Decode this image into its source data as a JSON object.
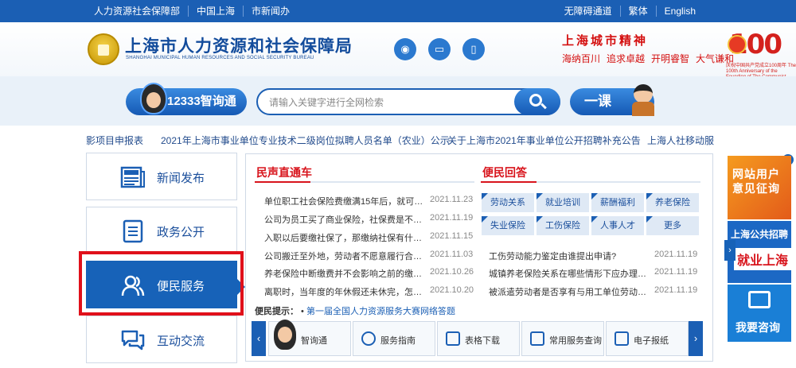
{
  "topbar": {
    "left_links": [
      "人力资源社会保障部",
      "中国上海",
      "市新闻办"
    ],
    "right_links": [
      "无障碍通道",
      "繁体",
      "English"
    ]
  },
  "header": {
    "logo_cn": "上海市人力资源和社会保障局",
    "logo_en": "SHANGHAI MUNICIPAL HUMAN RESOURCES AND SOCIAL SECURITY BUREAU",
    "slogan_title": "上海城市精神",
    "slogan_items": [
      "海纳百川",
      "追求卓越",
      "开明睿智",
      "大气谦和"
    ],
    "anniversary_number": "100",
    "anniversary_caption": "庆祝中国共产党成立100周年 The 100th Anniversary of the Founding of The Communist Party of China"
  },
  "search": {
    "btn_12333": "12333智询通",
    "placeholder": "请输入关键字进行全网检索",
    "btn_yike": "一课"
  },
  "ticker": {
    "items": [
      "影项目申报表",
      "2021年上海市事业单位专业技术二级岗位拟聘人员名单（农业）公示",
      "关于上海市2021年事业单位公开招聘补充公告",
      "上海人社移动服"
    ]
  },
  "nav": {
    "items": [
      {
        "label": "新闻发布"
      },
      {
        "label": "政务公开"
      },
      {
        "label": "便民服务"
      },
      {
        "label": "互动交流"
      }
    ]
  },
  "minsheng": {
    "title": "民声直通车",
    "rows": [
      {
        "title": "单位职工社会保险费缴满15年后，就可…",
        "date": "2021.11.23"
      },
      {
        "title": "公司为员工买了商业保险，社保费是不…",
        "date": "2021.11.19"
      },
      {
        "title": "入职以后要缴社保了，那缴纳社保有什…",
        "date": "2021.11.15"
      },
      {
        "title": "公司搬迁至外地，劳动者不愿意履行合…",
        "date": "2021.11.03"
      },
      {
        "title": "养老保险中断缴费并不会影响之前的缴…",
        "date": "2021.10.26"
      },
      {
        "title": "离职时，当年度的年休假还未休完，怎…",
        "date": "2021.10.20"
      }
    ]
  },
  "bianmin": {
    "title": "便民回答",
    "tags": [
      "劳动关系",
      "就业培训",
      "薪酬福利",
      "养老保险",
      "失业保险",
      "工伤保险",
      "人事人才",
      "更多"
    ],
    "rows": [
      {
        "title": "工伤劳动能力鉴定由谁提出申请?",
        "date": "2021.11.19"
      },
      {
        "title": "城镇养老保险关系在哪些情形下应办理…",
        "date": "2021.11.19"
      },
      {
        "title": "被派遣劳动者是否享有与用工单位劳动…",
        "date": "2021.11.19"
      }
    ]
  },
  "tip": {
    "label": "便民提示：",
    "text": "第一届全国人力资源服务大赛网络答题"
  },
  "quick": {
    "items": [
      "智询通",
      "服务指南",
      "表格下载",
      "常用服务查询",
      "电子报纸"
    ]
  },
  "right": {
    "banner1": "网站用户意见征询",
    "banner2_top": "上海公共招聘",
    "banner2_logo": "就业上海",
    "banner3": "我要咨询"
  },
  "colors": {
    "brand_blue": "#1b5fb4",
    "accent_red": "#d8141c",
    "highlight_red": "#e0101a"
  }
}
